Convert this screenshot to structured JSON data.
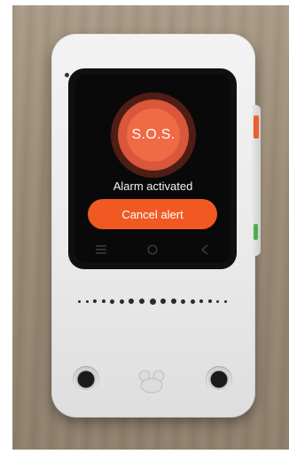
{
  "screen": {
    "sos_label": "S.O.S.",
    "status_text": "Alarm activated",
    "cancel_label": "Cancel alert"
  },
  "navigation": {
    "icons": [
      "menu-icon",
      "home-icon",
      "back-icon"
    ]
  },
  "colors": {
    "sos_button": "#f06a45",
    "sos_glow": "#d9573a",
    "cancel_button": "#f05a22",
    "device_body": "#ececec",
    "screen_background": "#090909"
  }
}
